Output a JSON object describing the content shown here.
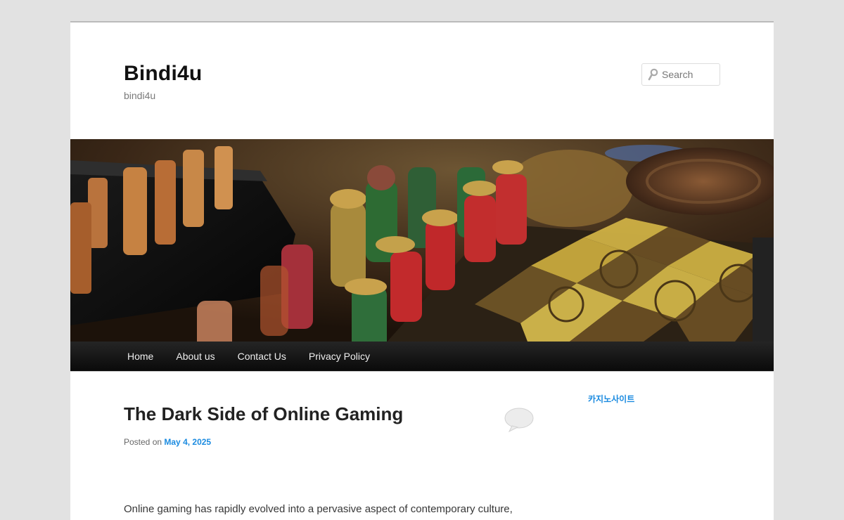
{
  "site": {
    "title": "Bindi4u",
    "description": "bindi4u"
  },
  "search": {
    "placeholder": "Search",
    "icon": "search-icon"
  },
  "banner": {
    "alt": "header image"
  },
  "nav": {
    "items": [
      {
        "label": "Home"
      },
      {
        "label": "About us"
      },
      {
        "label": "Contact Us"
      },
      {
        "label": "Privacy Policy"
      }
    ]
  },
  "post": {
    "title": "The Dark Side of Online Gaming",
    "meta_prefix": "Posted on",
    "date": "May 4, 2025",
    "excerpt": "Online gaming has rapidly evolved into a pervasive aspect of contemporary culture,"
  },
  "sidebar": {
    "link": "카지노사이트"
  },
  "colors": {
    "background": "#e2e2e2",
    "link": "#1b8be0",
    "nav": "#1a1a1a"
  }
}
